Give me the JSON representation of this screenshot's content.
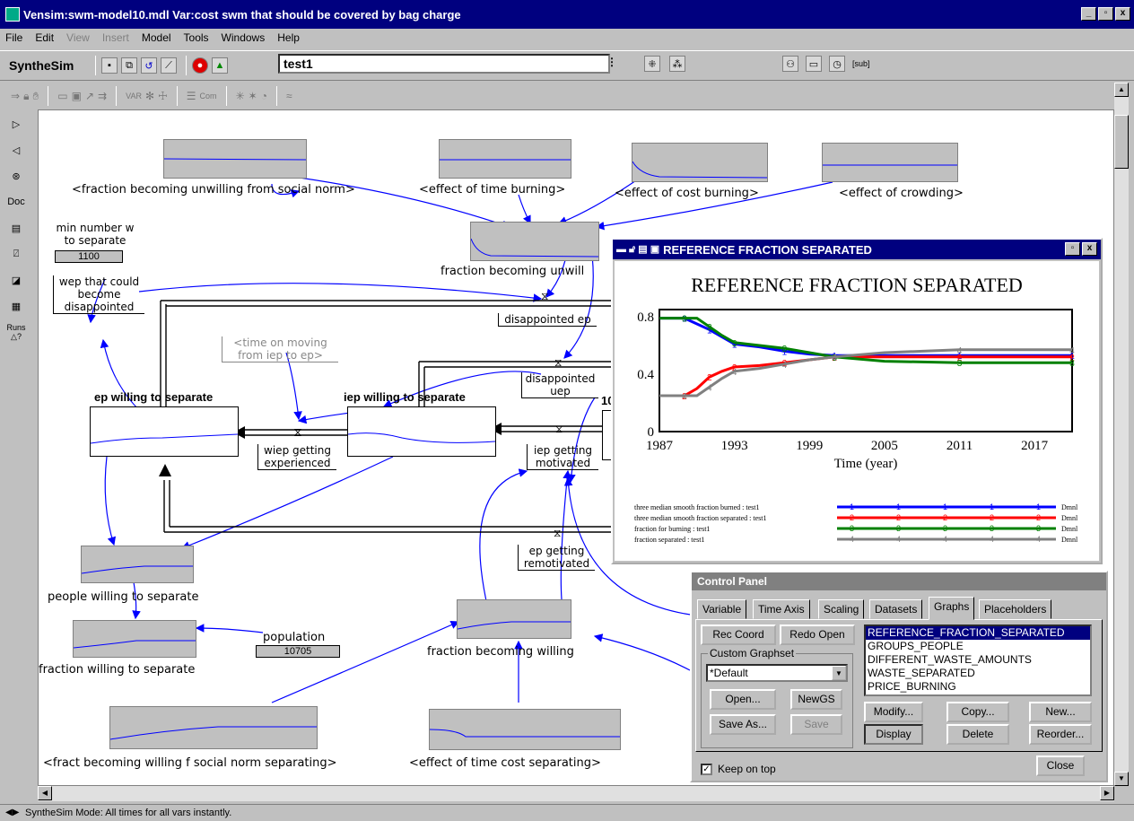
{
  "window": {
    "title": "Vensim:swm-model10.mdl Var:cost swm that should be covered by bag charge",
    "btn_min": "_",
    "btn_max": "▫",
    "btn_close": "x"
  },
  "menu": [
    {
      "label": "File",
      "disabled": false
    },
    {
      "label": "Edit",
      "disabled": false
    },
    {
      "label": "View",
      "disabled": true
    },
    {
      "label": "Insert",
      "disabled": true
    },
    {
      "label": "Model",
      "disabled": false
    },
    {
      "label": "Tools",
      "disabled": false
    },
    {
      "label": "Windows",
      "disabled": false
    },
    {
      "label": "Help",
      "disabled": false
    }
  ],
  "synthesim": {
    "label": "SyntheSim",
    "run_name": "test1",
    "sub_label": "[sub]"
  },
  "left_tools": {
    "doc": "Doc",
    "runs": "Runs △?"
  },
  "toolbar2": {
    "var": "VAR",
    "com": "Com"
  },
  "diagram": {
    "top_graph_labels": [
      "<fraction becoming unwilling from social norm>",
      "<effect of time burning>",
      "<effect of cost burning>",
      "<effect of crowding>"
    ],
    "fraction_unwilling": "fraction becoming unwill",
    "min_number_title": "min number w\nto separate",
    "min_number_value": "1100",
    "wep_label": "wep that could\nbecome\ndisappointed",
    "disappointed_ep": "disappointed ep",
    "time_on_moving": "<time on moving\nfrom iep to ep>",
    "disappointed_uep": "disappointed\nuep",
    "ep_title": "ep willing to separate",
    "iep_title": "iep willing to separate",
    "wiep": "wiep getting\nexperienced",
    "iep_getting": "iep getting\nmotivated",
    "ep_getting": "ep getting\nremotivated",
    "people_willing": "people willing to separate",
    "fraction_willing_sep": "fraction willing to separate",
    "population_label": "population",
    "population_value": "10705",
    "fraction_becoming_willing": "fraction becoming willing",
    "fract_social": "<fract becoming willing f social norm separating>",
    "effect_time_cost": "<effect of time cost separating>",
    "partial_10": "10"
  },
  "ref_window": {
    "title": "REFERENCE FRACTION SEPARATED",
    "legend": [
      {
        "label": "three median smooth fraction burned : test1",
        "marker": "1",
        "unit": "Dmnl"
      },
      {
        "label": "three median smooth fraction separated : test1",
        "marker": "2",
        "unit": "Dmnl"
      },
      {
        "label": "fraction for burning : test1",
        "marker": "3",
        "unit": "Dmnl"
      },
      {
        "label": "fraction separated : test1",
        "marker": "4",
        "unit": "Dmnl"
      }
    ]
  },
  "chart_data": {
    "type": "line",
    "title": "REFERENCE FRACTION SEPARATED",
    "xlabel": "Time (year)",
    "ylabel": "",
    "xlim": [
      1987,
      2020
    ],
    "ylim": [
      0,
      0.85
    ],
    "xticks": [
      "1987",
      "1993",
      "1999",
      "2005",
      "2011",
      "2017"
    ],
    "yticks": [
      "0",
      "0.4",
      "0.8"
    ],
    "x": [
      1987,
      1989,
      1990,
      1991,
      1992,
      1993,
      1995,
      1997,
      1999,
      2001,
      2005,
      2011,
      2017,
      2020
    ],
    "series": [
      {
        "name": "three median smooth fraction burned : test1",
        "color": "#0000ff",
        "values": [
          0.79,
          0.79,
          0.75,
          0.71,
          0.66,
          0.61,
          0.59,
          0.56,
          0.54,
          0.53,
          0.53,
          0.53,
          0.53,
          0.53
        ]
      },
      {
        "name": "three median smooth fraction separated : test1",
        "color": "#ff0000",
        "values": [
          0.25,
          0.25,
          0.3,
          0.38,
          0.42,
          0.45,
          0.46,
          0.48,
          0.5,
          0.52,
          0.52,
          0.52,
          0.52,
          0.52
        ]
      },
      {
        "name": "fraction for burning : test1",
        "color": "#008000",
        "values": [
          0.79,
          0.79,
          0.79,
          0.73,
          0.67,
          0.62,
          0.6,
          0.58,
          0.55,
          0.52,
          0.49,
          0.48,
          0.48,
          0.48
        ]
      },
      {
        "name": "fraction separated : test1",
        "color": "#808080",
        "values": [
          0.25,
          0.25,
          0.25,
          0.31,
          0.37,
          0.42,
          0.44,
          0.47,
          0.5,
          0.52,
          0.55,
          0.57,
          0.57,
          0.57
        ]
      }
    ]
  },
  "control_panel": {
    "title": "Control Panel",
    "tabs": [
      "Variable",
      "Time Axis",
      "Scaling",
      "Datasets",
      "Graphs",
      "Placeholders"
    ],
    "active_tab": "Graphs",
    "rec_coord": "Rec Coord",
    "redo_open": "Redo Open",
    "custom_graphset": "Custom Graphset",
    "select_value": "*Default",
    "open": "Open...",
    "newgs": "NewGS",
    "save_as": "Save As...",
    "save": "Save",
    "modify": "Modify...",
    "copy": "Copy...",
    "new": "New...",
    "display": "Display",
    "delete": "Delete",
    "reorder": "Reorder...",
    "close": "Close",
    "keep_on_top": "Keep on top",
    "graphs": [
      "REFERENCE_FRACTION_SEPARATED",
      "GROUPS_PEOPLE",
      "DIFFERENT_WASTE_AMOUNTS",
      "WASTE_SEPARATED",
      "PRICE_BURNING"
    ]
  },
  "status": "SyntheSim Mode: All times for all vars instantly."
}
